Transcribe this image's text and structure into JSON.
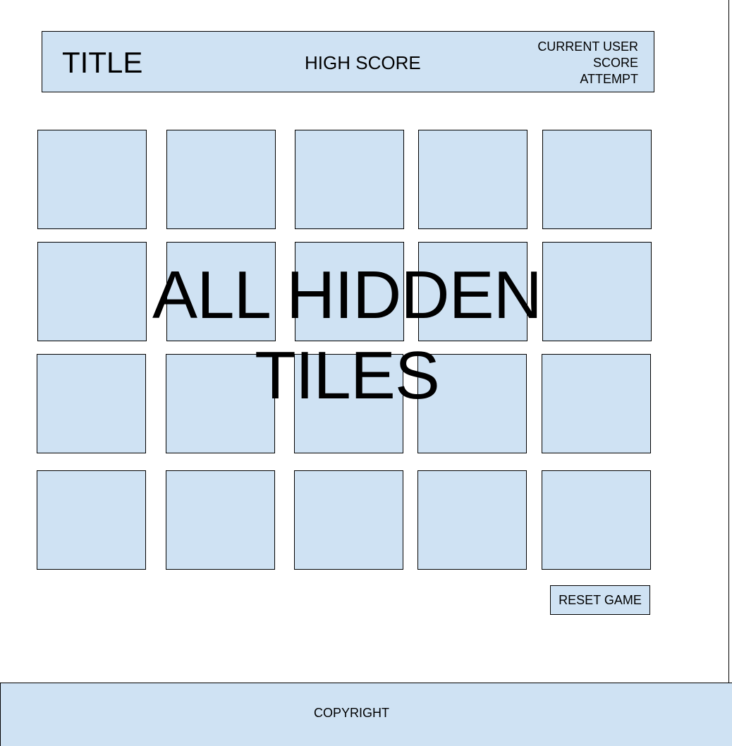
{
  "header": {
    "title": "TITLE",
    "high_score_label": "HIGH SCORE",
    "current_user_label": "CURRENT USER",
    "score_label": "SCORE",
    "attempt_label": "ATTEMPT"
  },
  "board": {
    "rows": 4,
    "columns": 5,
    "tile_count": 20,
    "overlay_line1": "ALL HIDDEN",
    "overlay_line2": "TILES"
  },
  "controls": {
    "reset_label": "RESET GAME"
  },
  "footer": {
    "copyright": "COPYRIGHT"
  },
  "colors": {
    "panel_fill": "#cfe2f3",
    "border": "#000000",
    "background": "#ffffff"
  }
}
